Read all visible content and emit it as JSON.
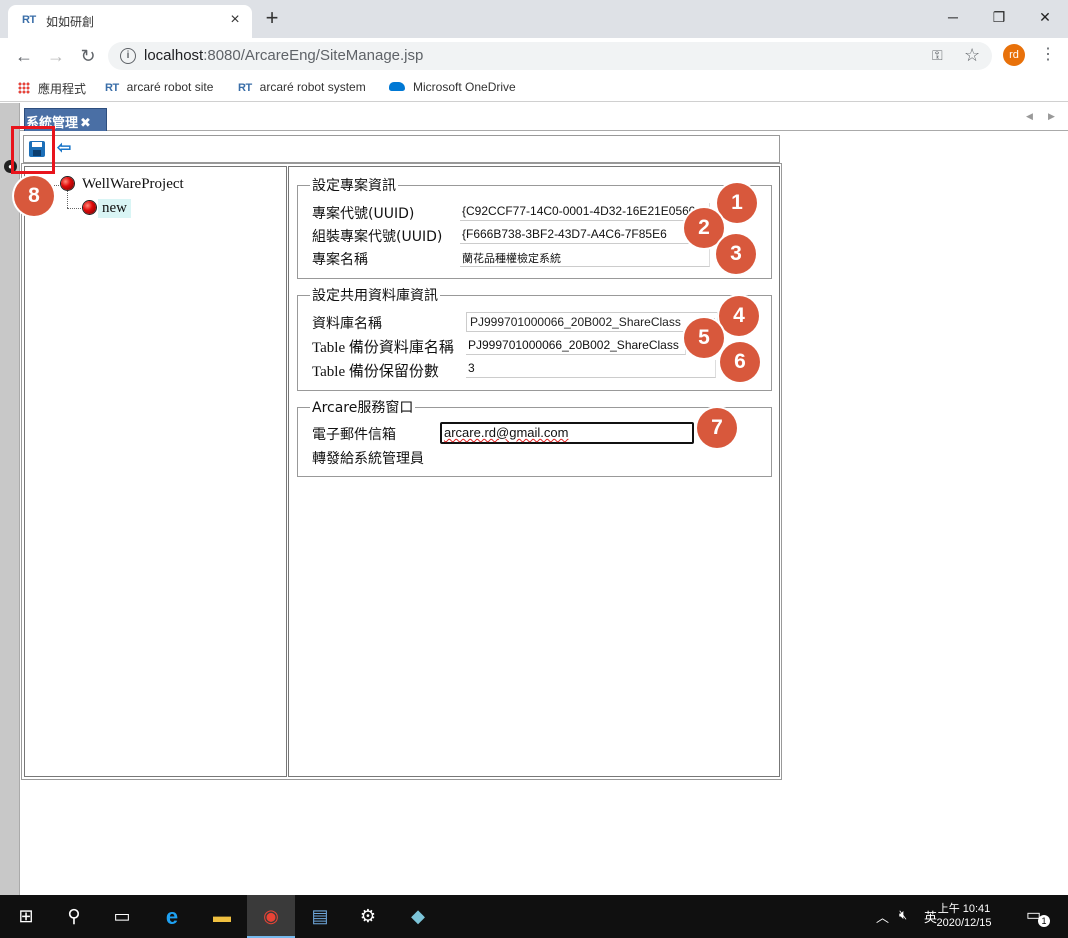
{
  "browser": {
    "tab_title": "如如研創",
    "favicon_text": "RT",
    "tab_close": "×",
    "new_tab": "+",
    "url_host": "localhost",
    "url_path": ":8080/ArcareEng/SiteManage.jsp",
    "profile_initials": "rd",
    "window_controls": {
      "minimize": "─",
      "maximize": "❐",
      "close": "✕"
    }
  },
  "bookmarks": [
    {
      "label": "應用程式",
      "icon": "apps-grid-icon"
    },
    {
      "label": "arcaré robot site",
      "icon": "rt-favicon"
    },
    {
      "label": "arcaré robot system",
      "icon": "rt-favicon"
    },
    {
      "label": "Microsoft OneDrive",
      "icon": "onedrive-cloud-icon"
    }
  ],
  "panel": {
    "tab_label": "系統管理",
    "tab_close": "✖"
  },
  "toolbar": {
    "save_icon": "floppy-disk-icon",
    "exit_icon": "exit-arrow-icon"
  },
  "tree": {
    "root_label": "WellWareProject",
    "child_label": "new"
  },
  "form": {
    "project_section": {
      "legend": "設定專案資訊",
      "uuid_label": "專案代號(UUID)",
      "uuid_value": "{C92CCF77-14C0-0001-4D32-16E21E0560",
      "assembly_uuid_label": "組裝專案代號(UUID)",
      "assembly_uuid_value": "{F666B738-3BF2-43D7-A4C6-7F85E6",
      "name_label": "專案名稱",
      "name_value": "蘭花品種權檢定系統"
    },
    "db_section": {
      "legend": "設定共用資料庫資訊",
      "db_name_label": "資料庫名稱",
      "db_name_value": "PJ999701000066_20B002_ShareClass",
      "backup_db_label": "Table 備份資料庫名稱",
      "backup_db_value": "PJ999701000066_20B002_ShareClass",
      "backup_count_label": "Table 備份保留份數",
      "backup_count_value": "3"
    },
    "service_section": {
      "legend": "Arcare服務窗口",
      "email_label": "電子郵件信箱",
      "email_value": "arcare.rd@gmail.com",
      "forward_label": "轉發給系統管理員"
    }
  },
  "annotations": [
    "1",
    "2",
    "3",
    "4",
    "5",
    "6",
    "7",
    "8"
  ],
  "taskbar": {
    "tray_language": "英",
    "clock_time": "上午 10:41",
    "clock_date": "2020/12/15",
    "notification_count": "1"
  },
  "colors": {
    "annotation_badge": "#d8583c",
    "highlight_box": "#e8141c",
    "panel_tab": "#4a6fa5"
  }
}
